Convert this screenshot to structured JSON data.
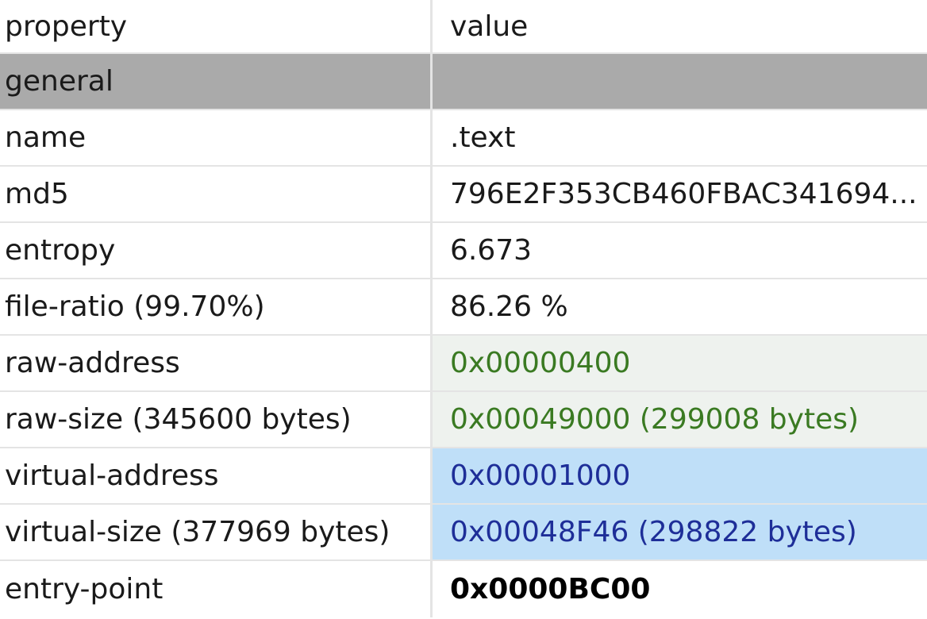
{
  "columns": {
    "property": "property",
    "value": "value"
  },
  "group": {
    "label": "general",
    "value": ""
  },
  "rows": [
    {
      "property": "name",
      "value": ".text"
    },
    {
      "property": "md5",
      "value": "796E2F353CB460FBAC341694..."
    },
    {
      "property": "entropy",
      "value": "6.673"
    },
    {
      "property": "file-ratio (99.70%)",
      "value": "86.26 %"
    },
    {
      "property": "raw-address",
      "value": "0x00000400"
    },
    {
      "property": "raw-size (345600 bytes)",
      "value": "0x00049000 (299008 bytes)"
    },
    {
      "property": "virtual-address",
      "value": "0x00001000"
    },
    {
      "property": "virtual-size (377969 bytes)",
      "value": "0x00048F46 (298822 bytes)"
    },
    {
      "property": "entry-point",
      "value": "0x0000BC00"
    }
  ],
  "colors": {
    "group_background": "#aaaaaa",
    "raw_value_background": "#eef2ee",
    "raw_value_text": "#3a7a22",
    "virtual_value_background": "#bfdff8",
    "virtual_value_text": "#1e2e98"
  }
}
